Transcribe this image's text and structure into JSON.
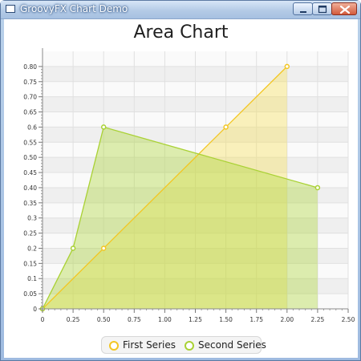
{
  "window": {
    "title": "GroovyFX Chart Demo"
  },
  "colors": {
    "series1": "#f3c623",
    "series2": "#a9d134",
    "fill1": "rgba(247, 224, 92, 0.40)",
    "fill2": "rgba(175, 215, 60, 0.40)"
  },
  "icons": [
    "window-app-icon",
    "minimize-icon",
    "maximize-icon",
    "close-icon"
  ],
  "chart_data": {
    "type": "area",
    "title": "Area Chart",
    "xlim": [
      0,
      2.5
    ],
    "ylim": [
      0,
      0.85
    ],
    "xticks": [
      {
        "v": 0,
        "label": "0"
      },
      {
        "v": 0.25,
        "label": "0.25"
      },
      {
        "v": 0.5,
        "label": "0.50"
      },
      {
        "v": 0.75,
        "label": "0.75"
      },
      {
        "v": 1.0,
        "label": "1.00"
      },
      {
        "v": 1.25,
        "label": "1.25"
      },
      {
        "v": 1.5,
        "label": "1.50"
      },
      {
        "v": 1.75,
        "label": "1.75"
      },
      {
        "v": 2.0,
        "label": "2.00"
      },
      {
        "v": 2.25,
        "label": "2.25"
      },
      {
        "v": 2.5,
        "label": "2.50"
      }
    ],
    "yticks": [
      {
        "v": 0,
        "label": "0"
      },
      {
        "v": 0.05,
        "label": "0.05"
      },
      {
        "v": 0.1,
        "label": "0.1"
      },
      {
        "v": 0.15,
        "label": "0.15"
      },
      {
        "v": 0.2,
        "label": "0.2"
      },
      {
        "v": 0.25,
        "label": "0.25"
      },
      {
        "v": 0.3,
        "label": "0.3"
      },
      {
        "v": 0.35,
        "label": "0.35"
      },
      {
        "v": 0.4,
        "label": "0.40"
      },
      {
        "v": 0.45,
        "label": "0.45"
      },
      {
        "v": 0.5,
        "label": "0.50"
      },
      {
        "v": 0.55,
        "label": "0.55"
      },
      {
        "v": 0.6,
        "label": "0.6"
      },
      {
        "v": 0.65,
        "label": "0.65"
      },
      {
        "v": 0.7,
        "label": "0.70"
      },
      {
        "v": 0.75,
        "label": "0.75"
      },
      {
        "v": 0.8,
        "label": "0.80"
      }
    ],
    "series": [
      {
        "name": "First Series",
        "x": [
          0,
          0.5,
          1.5,
          2.0
        ],
        "y": [
          0,
          0.2,
          0.6,
          0.8
        ]
      },
      {
        "name": "Second Series",
        "x": [
          0,
          0.25,
          0.5,
          2.25
        ],
        "y": [
          0,
          0.2,
          0.6,
          0.4
        ]
      }
    ],
    "legend_position": "bottom",
    "grid": true
  }
}
